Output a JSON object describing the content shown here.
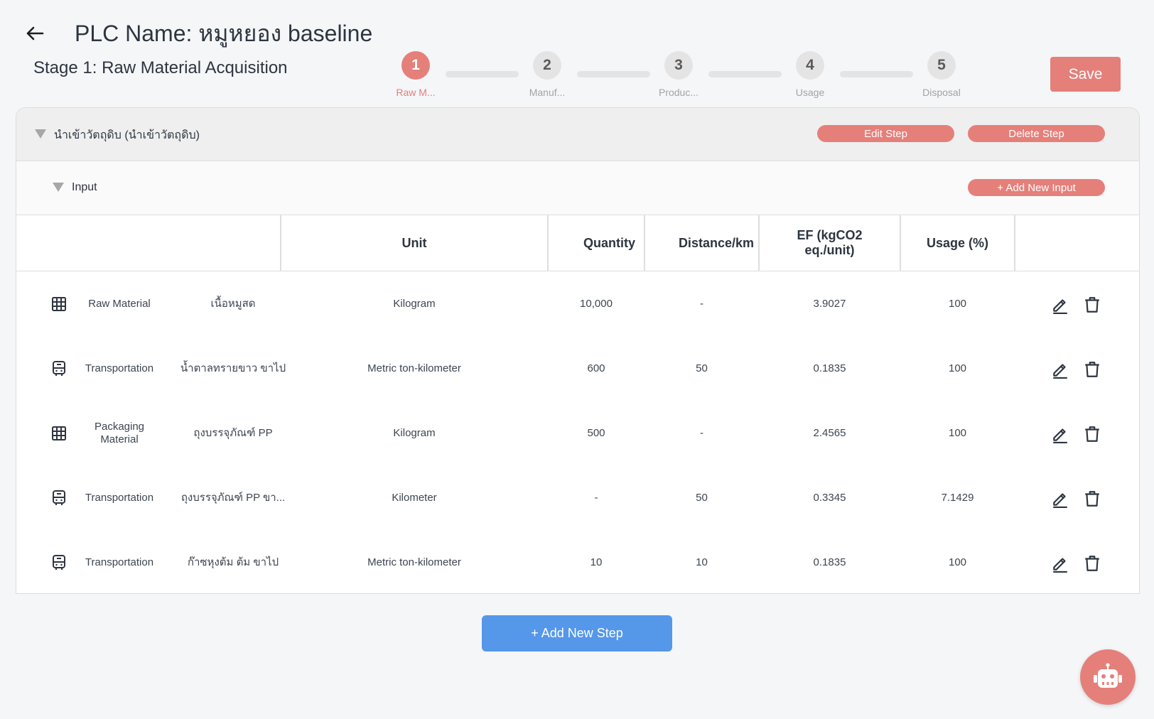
{
  "header": {
    "title": "PLC Name: หมูหยอง baseline",
    "stage_title": "Stage 1: Raw Material Acquisition",
    "save_label": "Save"
  },
  "stepper": {
    "steps": [
      {
        "number": "1",
        "label": "Raw M...",
        "active": true
      },
      {
        "number": "2",
        "label": "Manuf..."
      },
      {
        "number": "3",
        "label": "Produc..."
      },
      {
        "number": "4",
        "label": "Usage"
      },
      {
        "number": "5",
        "label": "Disposal"
      }
    ]
  },
  "step_block": {
    "name": "นำเข้าวัตถุดิบ (นำเข้าวัตถุดิบ)",
    "edit_label": "Edit Step",
    "delete_label": "Delete Step",
    "input_label": "Input",
    "add_input_label": "+ Add New Input"
  },
  "table": {
    "headers": {
      "unit": "Unit",
      "quantity": "Quantity",
      "distance": "Distance/km",
      "ef_line1": "EF (kgCO2",
      "ef_line2": "eq./unit)",
      "usage": "Usage (%)"
    },
    "rows": [
      {
        "type": "Raw Material",
        "icon": "grid-icon",
        "name": "เนื้อหมูสด",
        "unit": "Kilogram",
        "quantity": "10,000",
        "distance": "-",
        "ef": "3.9027",
        "usage": "100"
      },
      {
        "type": "Transportation",
        "icon": "bus-icon",
        "name": "น้ำตาลทรายขาว ขาไป",
        "unit": "Metric ton-kilometer",
        "quantity": "600",
        "distance": "50",
        "ef": "0.1835",
        "usage": "100"
      },
      {
        "type": "Packaging Material",
        "icon": "grid-icon",
        "name": "ถุงบรรจุภัณฑ์ PP",
        "unit": "Kilogram",
        "quantity": "500",
        "distance": "-",
        "ef": "2.4565",
        "usage": "100"
      },
      {
        "type": "Transportation",
        "icon": "bus-icon",
        "name": "ถุงบรรจุภัณฑ์ PP ขา...",
        "unit": "Kilometer",
        "quantity": "-",
        "distance": "50",
        "ef": "0.3345",
        "usage": "7.1429"
      },
      {
        "type": "Transportation",
        "icon": "bus-icon",
        "name": "ก๊าซหุงต้ม ต้ม ขาไป",
        "unit": "Metric ton-kilometer",
        "quantity": "10",
        "distance": "10",
        "ef": "0.1835",
        "usage": "100"
      }
    ]
  },
  "add_step_label": "+ Add New Step",
  "colors": {
    "accent": "#e57f7a",
    "primary_blue": "#5597e9",
    "inactive_step": "#e4e4e4"
  }
}
